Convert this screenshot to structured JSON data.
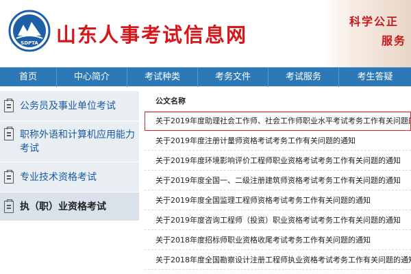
{
  "header": {
    "logo_text": "SDPTA",
    "site_title": "山东人事考试信息网",
    "slogan_line1": "科学公正",
    "slogan_line2": "服务"
  },
  "nav": {
    "items": [
      "首页",
      "中心简介",
      "考试种类",
      "考务文件",
      "考试服务",
      "考生答疑"
    ]
  },
  "sidebar": {
    "items": [
      {
        "label": "公务员及事业单位考试"
      },
      {
        "label": "职称外语和计算机应用能力考试"
      },
      {
        "label": "专业技术资格考试"
      },
      {
        "label": "执（职）业资格考试"
      }
    ]
  },
  "table": {
    "column_header": "公文名称",
    "rows": [
      "关于2019年度助理社会工作师、社会工作师职业水平考试考务工作有关问题的通知",
      "关于2019年度注册计量师资格考试考务工作有关问题的通知",
      "关于2019年度环境影响评价工程师职业资格考试考务工作有关问题的通知",
      "关于2019年度全国一、二级注册建筑师资格考试考务工作有关问题的通知",
      "关于2019年度全国监理工程师资格考试考务工作有关问题的通知",
      "关于2019年度咨询工程师（投资）职业资格考试考务工作有关问题的通知",
      "关于2018年度招标师职业资格收尾考试考务工作有关问题的通知",
      "关于2018年度全国勘察设计注册工程师执业资格考试考务工作有关问题的通知"
    ]
  },
  "colors": {
    "brand_red": "#d5161b",
    "nav_blue": "#2d79b7",
    "sidebar_bg": "#e9eef3",
    "link_blue": "#1a5aa0",
    "highlight_border": "#d9262b"
  }
}
